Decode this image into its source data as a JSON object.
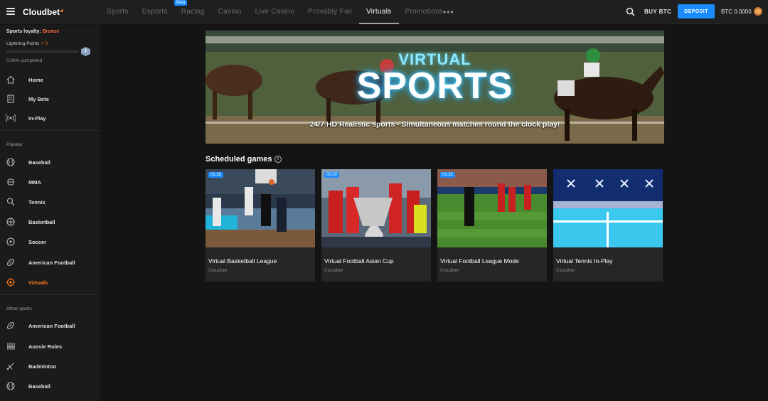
{
  "header": {
    "logo": "Cloudbet",
    "nav": [
      {
        "label": "Sports"
      },
      {
        "label": "Esports"
      },
      {
        "label": "Racing",
        "badge": "Beta"
      },
      {
        "label": "Casino"
      },
      {
        "label": "Live Casino"
      },
      {
        "label": "Provably Fair"
      },
      {
        "label": "Virtuals",
        "active": true
      },
      {
        "label": "Promotions"
      }
    ],
    "buy_label": "BUY BTC",
    "deposit_label": "DEPOSIT",
    "balance": "BTC 0.0000"
  },
  "sidebar": {
    "loyalty_label": "Sports loyalty:",
    "loyalty_tier": "Bronze",
    "lp_label": "Lightning Points",
    "lp_value": "0",
    "level": "1",
    "progress_fraction": 0.0,
    "completed": "0.00% completed",
    "main_items": [
      {
        "label": "Home",
        "icon": "home-icon"
      },
      {
        "label": "My Bets",
        "icon": "bets-icon"
      },
      {
        "label": "In-Play",
        "icon": "live-icon"
      }
    ],
    "popular_title": "Popular",
    "popular_items": [
      {
        "label": "Baseball",
        "icon": "baseball-icon"
      },
      {
        "label": "MMA",
        "icon": "mma-icon"
      },
      {
        "label": "Tennis",
        "icon": "tennis-icon"
      },
      {
        "label": "Basketball",
        "icon": "basketball-icon"
      },
      {
        "label": "Soccer",
        "icon": "soccer-icon"
      },
      {
        "label": "American Football",
        "icon": "american-football-icon"
      },
      {
        "label": "Virtuals",
        "icon": "virtuals-icon",
        "active": true
      }
    ],
    "other_title": "Other sports",
    "other_items": [
      {
        "label": "American Football",
        "icon": "american-football-icon"
      },
      {
        "label": "Aussie Rules",
        "icon": "aussie-rules-icon"
      },
      {
        "label": "Badminton",
        "icon": "badminton-icon"
      },
      {
        "label": "Baseball",
        "icon": "baseball-icon"
      }
    ]
  },
  "banner": {
    "title_top": "VIRTUAL",
    "title_main": "SPORTS",
    "subtitle": "24/7 HD Realistic sports - Simultaneous matches round the clock play!"
  },
  "scheduled": {
    "title": "Scheduled games",
    "games": [
      {
        "name": "Virtual Basketball League",
        "provider": "Cloudbet",
        "time": "01:32",
        "theme": "basketball"
      },
      {
        "name": "Virtual Football Asian Cup",
        "provider": "Cloudbet",
        "time": "00:20",
        "theme": "cup"
      },
      {
        "name": "Virtual Football League Mode",
        "provider": "Cloudbet",
        "time": "01:22",
        "theme": "football"
      },
      {
        "name": "Virtual Tennis In-Play",
        "provider": "Cloudbet",
        "time": "",
        "theme": "tennis"
      }
    ]
  },
  "colors": {
    "accent": "#1a8cff",
    "active": "#ff7a1a",
    "bronze": "#ff6a3d"
  }
}
